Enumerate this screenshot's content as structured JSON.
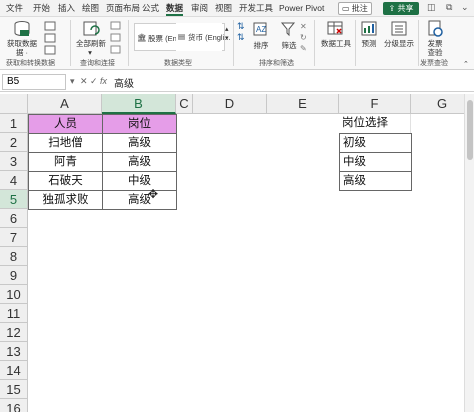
{
  "ribbon_tabs": [
    "文件",
    "开始",
    "插入",
    "绘图",
    "页面布局",
    "公式",
    "数据",
    "审阅",
    "视图",
    "开发工具",
    "Power Pivot"
  ],
  "active_tab": "数据",
  "top_right": {
    "comment": "批注",
    "share": "共享"
  },
  "ribbon": {
    "get_data": "获取数据",
    "get_data_sub": "据 ·",
    "refresh_all": "全部刷新",
    "group1_label": "获取和转换数据",
    "group2_label": "查询和连接",
    "stocks": "股票 (Engli...",
    "currency": "货币 (Engli...",
    "group3_label": "数据类型",
    "sort": "排序",
    "filter": "筛选",
    "group4_label": "排序和筛选",
    "data_tools": "数据工具",
    "forecast": "预测",
    "outline": "分级显示",
    "invoice": "发票查验",
    "group5_label": "发票查验"
  },
  "formula_bar": {
    "name_box": "B5",
    "fx": "fx",
    "content": "高级"
  },
  "columns": [
    "A",
    "B",
    "C",
    "D",
    "E",
    "F",
    "G"
  ],
  "rows": [
    "1",
    "2",
    "3",
    "4",
    "5",
    "6",
    "7",
    "8",
    "9",
    "10",
    "11",
    "12",
    "13",
    "14",
    "15",
    "16"
  ],
  "table": {
    "headers": [
      "人员",
      "岗位"
    ],
    "rows": [
      [
        "扫地僧",
        "高级"
      ],
      [
        "阿青",
        "高级"
      ],
      [
        "石破天",
        "中级"
      ],
      [
        "独孤求败",
        "高级"
      ]
    ]
  },
  "position_list": {
    "title": "岗位选择",
    "items": [
      "初级",
      "中级",
      "高级"
    ]
  },
  "colors": {
    "header_fill": "#e59de8",
    "excel_green": "#1e7145"
  }
}
